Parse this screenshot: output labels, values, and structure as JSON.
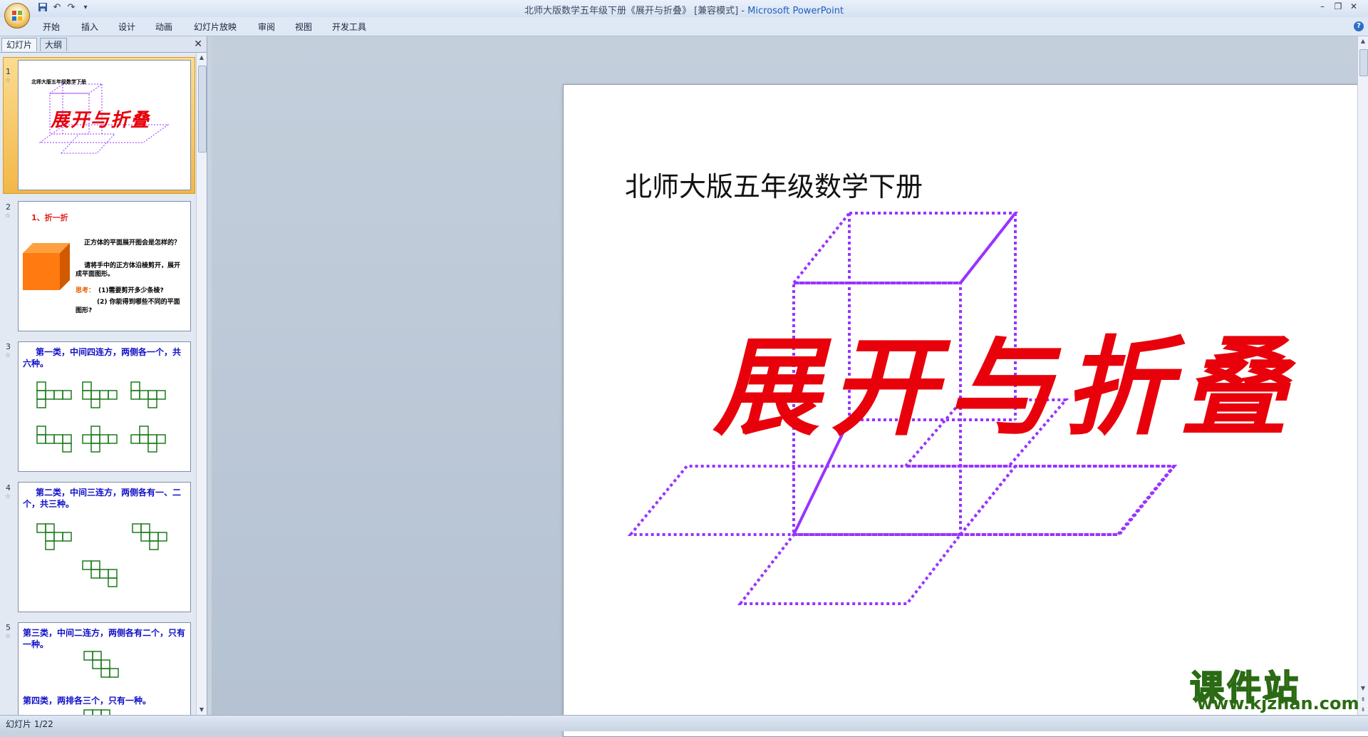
{
  "window": {
    "title_doc": "北师大版数学五年级下册《展开与折叠》 [兼容模式] - ",
    "title_app": "Microsoft PowerPoint",
    "minimize": "–",
    "restore": "❐",
    "close": "✕"
  },
  "quick_access": {
    "save_icon": "save-icon",
    "undo": "↶",
    "redo": "↷",
    "customize": "▾"
  },
  "ribbon_tabs": [
    "开始",
    "插入",
    "设计",
    "动画",
    "幻灯片放映",
    "审阅",
    "视图",
    "开发工具"
  ],
  "help": "?",
  "panel": {
    "tab_slides": "幻灯片",
    "tab_outline": "大纲",
    "close": "✕"
  },
  "thumbnails": [
    {
      "num": "1",
      "subtitle": "北师大版五年级数学下册",
      "title": "展开与折叠"
    },
    {
      "num": "2",
      "heading": "1、折一折",
      "line1": "正方体的平面展开图会是怎样的？",
      "line2": "请将手中的正方体沿棱剪开，展开成平面图形。",
      "think_label": "思考：",
      "q1": "(1)需要剪开多少条棱?",
      "q2": "(2) 你能得到哪些不同的平面图形?"
    },
    {
      "num": "3",
      "heading": "第一类，中间四连方，两侧各一个，共六种。"
    },
    {
      "num": "4",
      "heading": "第二类，中间三连方，两侧各有一、二个，共三种。"
    },
    {
      "num": "5",
      "heading": "第三类，中间二连方，两侧各有二个，只有一种。",
      "heading2": "第四类，两排各三个，只有一种。"
    }
  ],
  "slide": {
    "subtitle": "北师大版五年级数学下册",
    "title": "展开与折叠",
    "title_color": "#e8000b",
    "dotted_color": "#9933ff"
  },
  "status": {
    "slide_counter": "幻灯片 1/22"
  },
  "watermark": {
    "cn": "课件站",
    "url": "www.kjzhan.com"
  }
}
